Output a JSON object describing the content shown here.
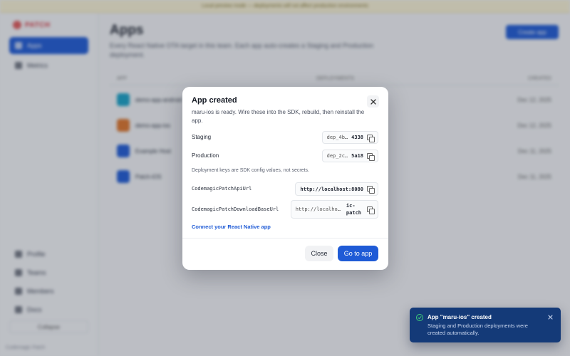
{
  "background": {
    "banner_text": "Local preview mode — deployments will not affect production environments",
    "brand": "PATCH",
    "nav": [
      {
        "label": "Apps"
      },
      {
        "label": "Metrics"
      }
    ],
    "nav_bottom": [
      {
        "label": "Profile"
      },
      {
        "label": "Teams"
      },
      {
        "label": "Members"
      },
      {
        "label": "Docs"
      }
    ],
    "collapse_label": "Collapse",
    "footer_text": "Codemagic Patch",
    "page_title": "Apps",
    "page_subtitle": "Every React Native OTA target in this team. Each app auto-creates a Staging and Production deployment.",
    "create_button": "Create app",
    "table_headers": {
      "app": "APP",
      "deployments": "DEPLOYMENTS",
      "created": "CREATED"
    },
    "rows": [
      {
        "name": "demo-app-android",
        "date": "Dec 12, 2025"
      },
      {
        "name": "demo-app-ios",
        "date": "Dec 12, 2025"
      },
      {
        "name": "Example Host",
        "date": "Dec 11, 2025"
      },
      {
        "name": "Patch-iOS",
        "date": "Dec 11, 2025"
      }
    ]
  },
  "modal": {
    "title": "App created",
    "description": "maru-ios is ready. Wire these into the SDK, rebuild, then reinstall the app.",
    "staging": {
      "label": "Staging",
      "key_prefix": "dep_4b…",
      "key_suffix": "4338"
    },
    "production": {
      "label": "Production",
      "key_prefix": "dep_2c…",
      "key_suffix": "5a18"
    },
    "note": "Deployment keys are SDK config values, not secrets.",
    "api_url": {
      "label": "CodemagicPatchApiUrl",
      "value": "http://localhost:8080"
    },
    "download_url": {
      "label": "CodemagicPatchDownloadBaseUrl",
      "prefix": "http://localho…",
      "suffix_line1": "ic-",
      "suffix_line2": "patch"
    },
    "link": "Connect your React Native app",
    "close_button": "Close",
    "primary_button": "Go to app"
  },
  "toast": {
    "title": "App \"maru-ios\" created",
    "body": "Staging and Production deployments were created automatically."
  },
  "colors": {
    "accent": "#1f5bd6",
    "toast_bg": "#143a78",
    "success": "#3ecf7a"
  }
}
